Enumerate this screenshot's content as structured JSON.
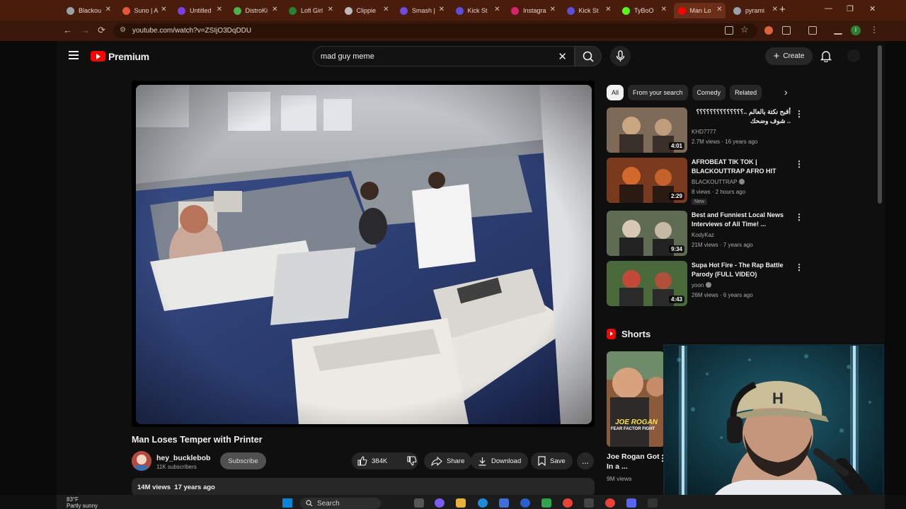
{
  "browser": {
    "tabs": [
      {
        "label": "Blackou",
        "color": "#9aa0a6"
      },
      {
        "label": "Suno | A",
        "color": "#e8543a"
      },
      {
        "label": "Untitled",
        "color": "#7b3fe4"
      },
      {
        "label": "DistroKi",
        "color": "#4caf50"
      },
      {
        "label": "Lofi Girl",
        "color": "#2e7d32"
      },
      {
        "label": "Clippie",
        "color": "#bbbbbb"
      },
      {
        "label": "Smash |",
        "color": "#6e4bd8"
      },
      {
        "label": "Kick St",
        "color": "#5b4ed8"
      },
      {
        "label": "Instagra",
        "color": "#d6246e"
      },
      {
        "label": "Kick St",
        "color": "#5b4ed8"
      },
      {
        "label": "TyBoO",
        "color": "#53fc18"
      },
      {
        "label": "Man Lo",
        "color": "#ff0000"
      },
      {
        "label": "pyrami",
        "color": "#9aa0a6"
      }
    ],
    "url": "youtube.com/watch?v=ZSIjO3DqDDU",
    "profile_initial": "I"
  },
  "header": {
    "logo_text": "Premium",
    "search_query": "mad guy meme",
    "create_label": "Create"
  },
  "video": {
    "title": "Man Loses Temper with Printer",
    "channel": "hey_bucklebob",
    "subscribers": "11K subscribers",
    "subscribe_label": "Subscribe",
    "likes": "384K",
    "share_label": "Share",
    "download_label": "Download",
    "save_label": "Save",
    "more_label": "...",
    "views": "14M views",
    "age": "17 years ago"
  },
  "chips": [
    "All",
    "From your search",
    "Comedy",
    "Related"
  ],
  "recommendations": [
    {
      "title": "أقبح نكتة بالعالم ..؟؟؟؟؟؟؟؟؟؟؟؟؟؟ .. شوف وضحك",
      "channel": "KHD7777",
      "meta": "2.7M views · 16 years ago",
      "duration": "4:01",
      "verified": false,
      "new": false
    },
    {
      "title": "AFROBEAT TIK TOK | BLACKOUTTRAP AFRO HIT",
      "channel": "BLACKOUTTRAP",
      "meta": "8 views · 2 hours ago",
      "duration": "2:29",
      "verified": true,
      "new": true,
      "new_label": "New"
    },
    {
      "title": "Best and Funniest Local News Interviews of All Time! ...",
      "channel": "KodyKaz",
      "meta": "21M views · 7 years ago",
      "duration": "9:34",
      "verified": false,
      "new": false
    },
    {
      "title": "Supa Hot Fire - The Rap Battle Parody (FULL VIDEO) [DeShaw...",
      "channel": "yoon",
      "meta": "26M views · 6 years ago",
      "duration": "4:43",
      "verified": true,
      "new": false
    }
  ],
  "shorts": {
    "heading": "Shorts",
    "items": [
      {
        "title": "Joe Rogan Got In a ...",
        "views": "9M views",
        "overlay_line1": "JOE ROGAN",
        "overlay_line2": "FEAR FACTOR FIGHT"
      }
    ]
  },
  "taskbar": {
    "temperature": "83°F",
    "weather": "Partly sunny",
    "search_label": "Search"
  }
}
